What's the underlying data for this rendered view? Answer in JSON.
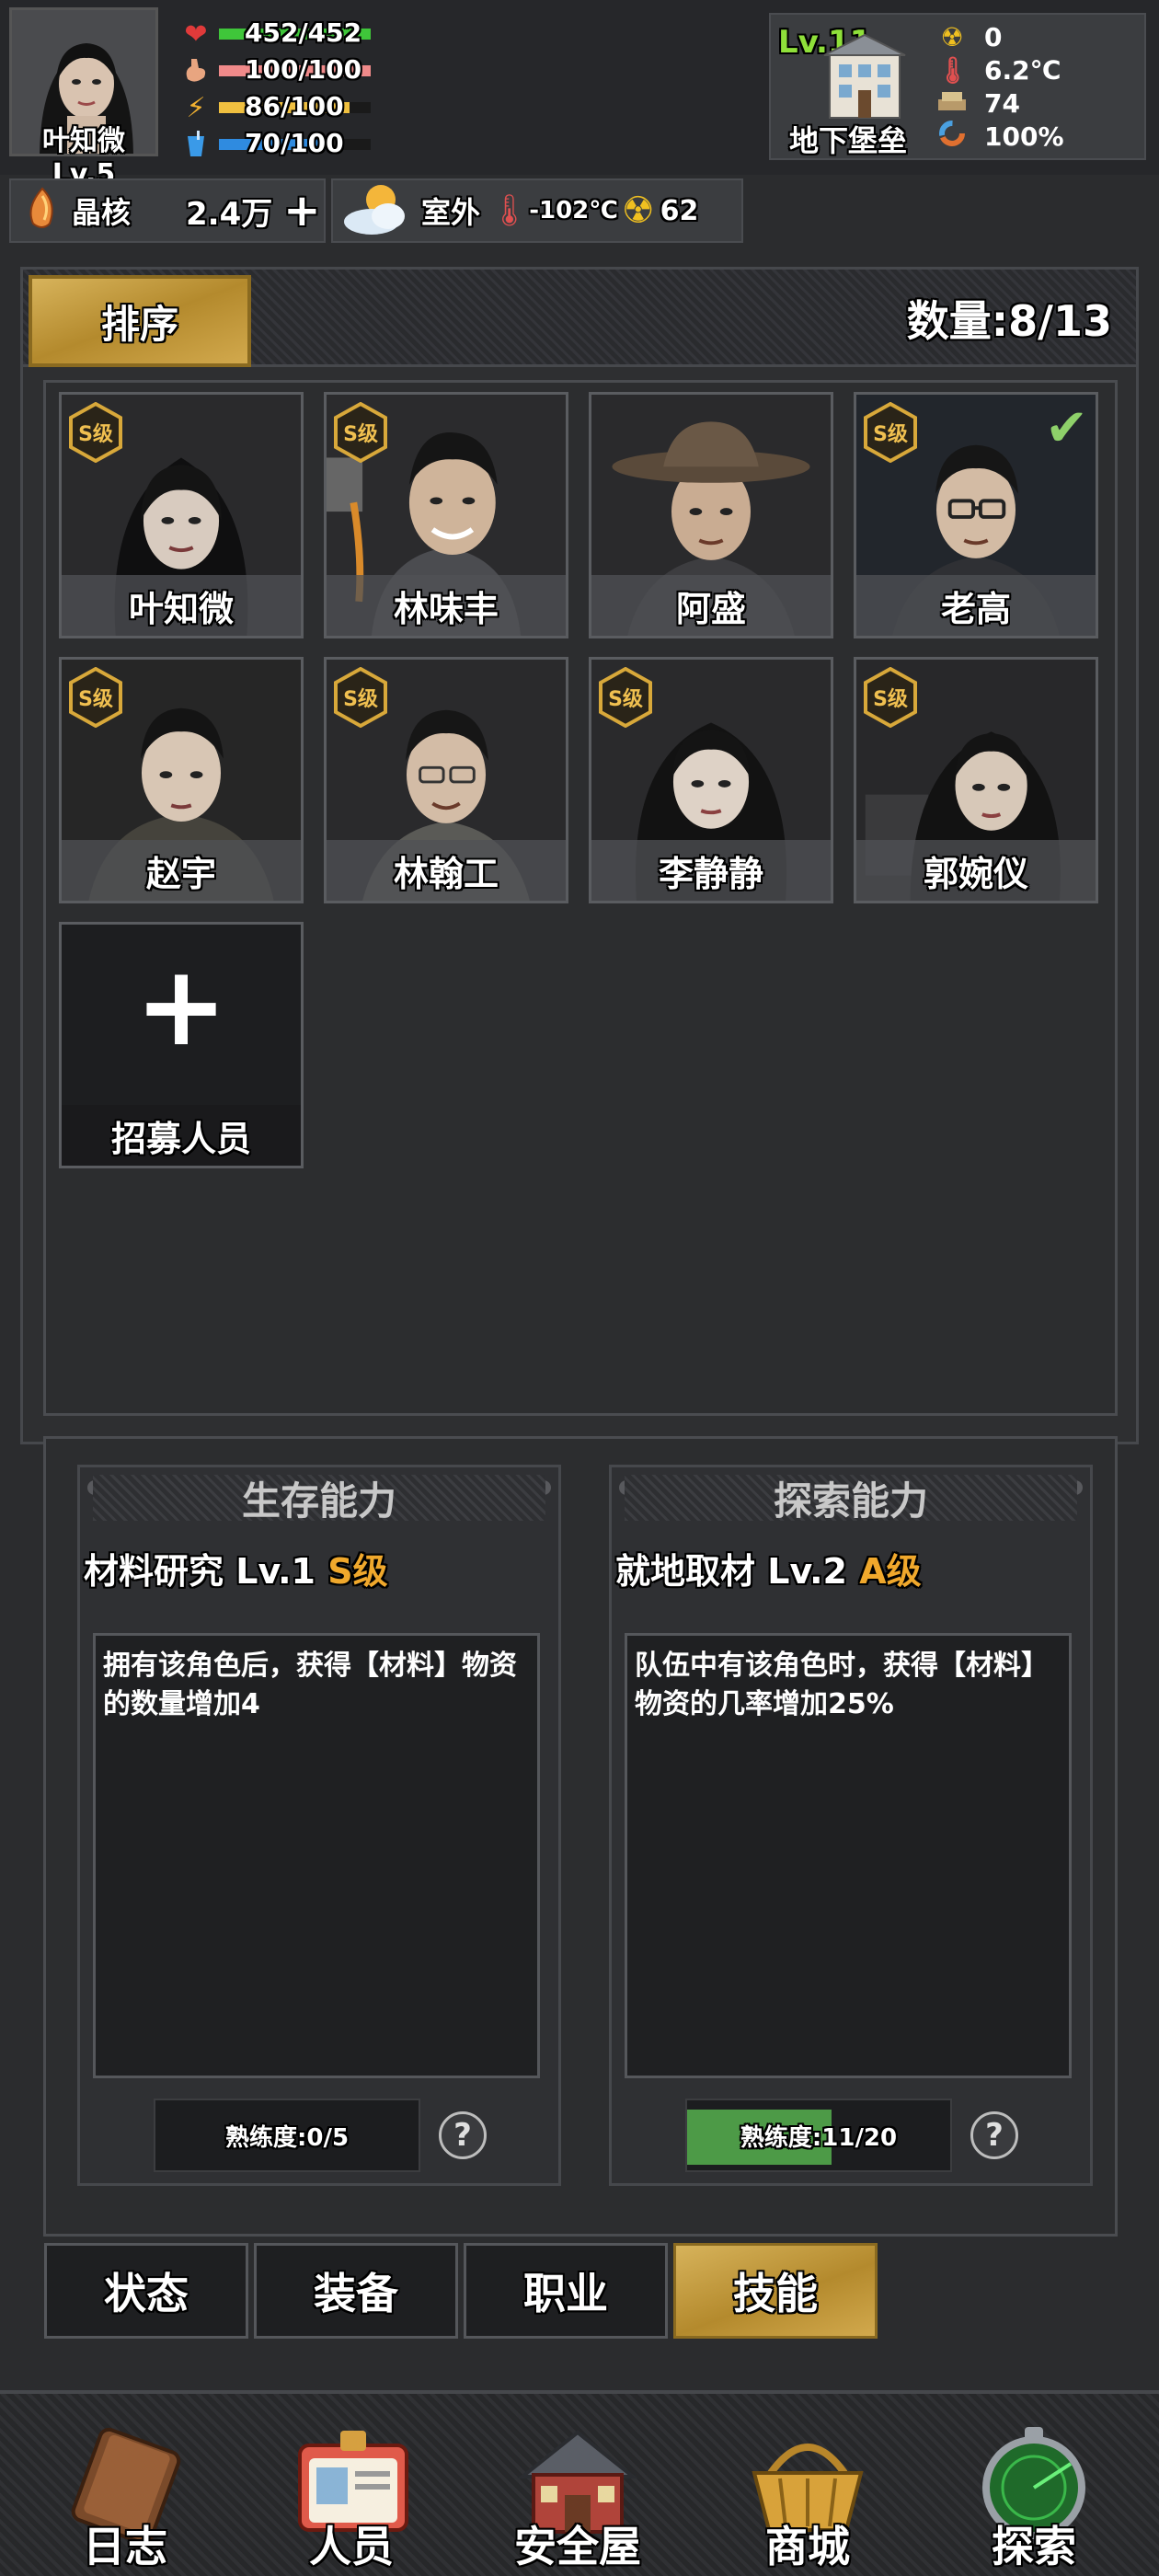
{
  "player": {
    "name_level": "叶知微 Lv.5",
    "hp": "452/452",
    "hunger": "100/100",
    "energy": "86/100",
    "thirst": "70/100",
    "hp_fill": 1.0,
    "hunger_fill": 1.0,
    "energy_fill": 0.86,
    "thirst_fill": 0.7
  },
  "base": {
    "level": "Lv.11",
    "name": "地下堡垒",
    "radiation": "0",
    "temperature": "6.2℃",
    "supplies": "74",
    "integrity": "100%"
  },
  "resources": {
    "crystal_label": "晶核",
    "crystal_value": "2.4万",
    "plus": "+",
    "location": "室外",
    "outdoor_temp": "-102℃",
    "outdoor_radiation": "62"
  },
  "roster": {
    "sort_label": "排序",
    "count": "数量:8/13",
    "rank_label": "S级",
    "recruit_label": "招募人员",
    "members": [
      {
        "name": "叶知微",
        "rank": "S级",
        "selected": false
      },
      {
        "name": "林味丰",
        "rank": "S级",
        "selected": false
      },
      {
        "name": "阿盛",
        "rank": "",
        "selected": false
      },
      {
        "name": "老高",
        "rank": "S级",
        "selected": true
      },
      {
        "name": "赵宇",
        "rank": "S级",
        "selected": false
      },
      {
        "name": "林翰工",
        "rank": "S级",
        "selected": false
      },
      {
        "name": "李静静",
        "rank": "S级",
        "selected": false
      },
      {
        "name": "郭婉仪",
        "rank": "S级",
        "selected": false
      }
    ]
  },
  "skills": {
    "survival": {
      "title": "生存能力",
      "name": "材料研究 Lv.1",
      "grade": "S级",
      "description": "拥有该角色后，获得【材料】物资的数量增加4",
      "proficiency": "熟练度:0/5",
      "proficiency_fill": 0.0
    },
    "explore": {
      "title": "探索能力",
      "name": "就地取材 Lv.2",
      "grade": "A级",
      "description": "队伍中有该角色时，获得【材料】物资的几率增加25%",
      "proficiency": "熟练度:11/20",
      "proficiency_fill": 0.55
    },
    "help": "?"
  },
  "detail_tabs": [
    {
      "label": "状态",
      "active": false
    },
    {
      "label": "装备",
      "active": false
    },
    {
      "label": "职业",
      "active": false
    },
    {
      "label": "技能",
      "active": true
    }
  ],
  "nav": [
    {
      "label": "日志",
      "icon": "journal-icon"
    },
    {
      "label": "人员",
      "icon": "id-card-icon"
    },
    {
      "label": "安全屋",
      "icon": "house-icon"
    },
    {
      "label": "商城",
      "icon": "basket-icon"
    },
    {
      "label": "探索",
      "icon": "radar-icon"
    }
  ],
  "colors": {
    "hp": "#3fc63a",
    "hunger": "#f08a8a",
    "energy": "#f0c040",
    "thirst": "#2f8be0",
    "gold": "#d2a94d"
  }
}
